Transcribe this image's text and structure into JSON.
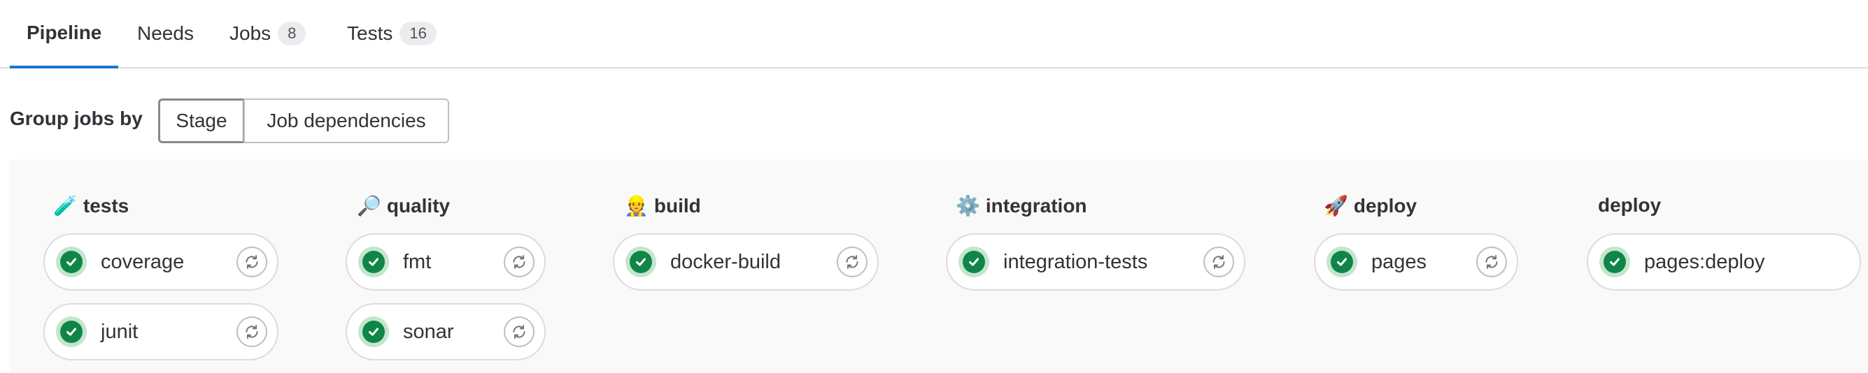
{
  "tabs": [
    {
      "label": "Pipeline",
      "count": null,
      "active": true
    },
    {
      "label": "Needs",
      "count": null,
      "active": false
    },
    {
      "label": "Jobs",
      "count": "8",
      "active": false
    },
    {
      "label": "Tests",
      "count": "16",
      "active": false
    }
  ],
  "group_by": {
    "label": "Group jobs by",
    "options": [
      "Stage",
      "Job dependencies"
    ],
    "selected": "Stage"
  },
  "stages": [
    {
      "emoji": "🧪",
      "name": "tests",
      "jobs": [
        {
          "name": "coverage",
          "status": "passed",
          "retry": true
        },
        {
          "name": "junit",
          "status": "passed",
          "retry": true
        }
      ]
    },
    {
      "emoji": "🔎",
      "name": "quality",
      "jobs": [
        {
          "name": "fmt",
          "status": "passed",
          "retry": true
        },
        {
          "name": "sonar",
          "status": "passed",
          "retry": true
        }
      ]
    },
    {
      "emoji": "👷",
      "name": "build",
      "jobs": [
        {
          "name": "docker-build",
          "status": "passed",
          "retry": true
        }
      ]
    },
    {
      "emoji": "⚙️",
      "name": "integration",
      "jobs": [
        {
          "name": "integration-tests",
          "status": "passed",
          "retry": true
        }
      ]
    },
    {
      "emoji": "🚀",
      "name": "deploy",
      "jobs": [
        {
          "name": "pages",
          "status": "passed",
          "retry": true
        }
      ]
    },
    {
      "emoji": "",
      "name": "deploy",
      "jobs": [
        {
          "name": "pages:deploy",
          "status": "passed",
          "retry": false
        }
      ]
    }
  ],
  "colors": {
    "accent": "#1f75cb",
    "success": "#108548",
    "success_ring": "#c3e6cd",
    "panel_bg": "#f9f9fa"
  },
  "icons": {
    "status": "check-circle-icon",
    "retry": "retry-icon"
  }
}
